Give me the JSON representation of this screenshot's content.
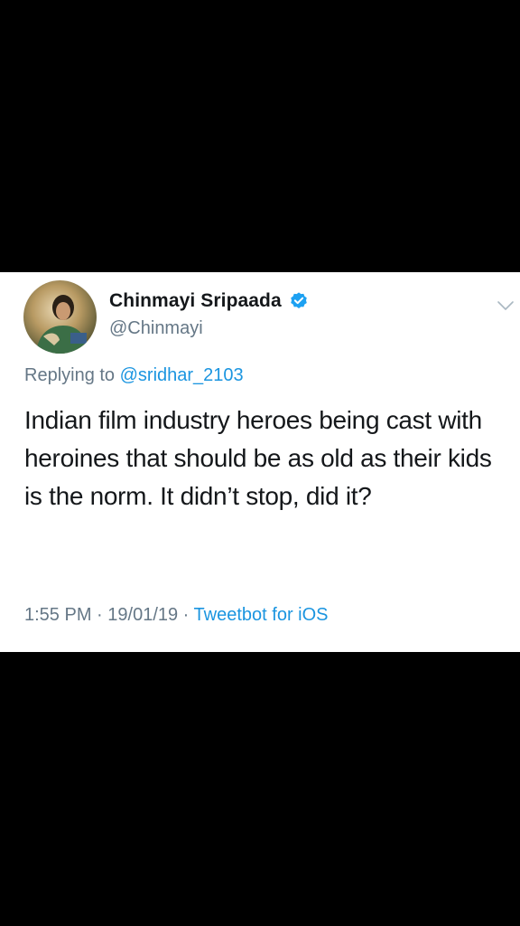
{
  "tweet": {
    "display_name": "Chinmayi Sripaada",
    "handle": "@Chinmayi",
    "replying_prefix": "Replying to ",
    "replying_mention": "@sridhar_2103",
    "text": "Indian film industry heroes being cast with heroines that should be as old as their kids is the norm. It didn’t stop, did it?",
    "time": "1:55 PM",
    "separator": " · ",
    "date": "19/01/19",
    "source": "Tweetbot for iOS"
  },
  "icons": {
    "verified": "verified-badge-icon",
    "menu": "chevron-down-icon",
    "avatar": "profile-avatar"
  },
  "colors": {
    "background": "#000000",
    "card": "#ffffff",
    "text": "#14171a",
    "secondary": "#657786",
    "link": "#1b95e0",
    "verified": "#1da1f2"
  }
}
